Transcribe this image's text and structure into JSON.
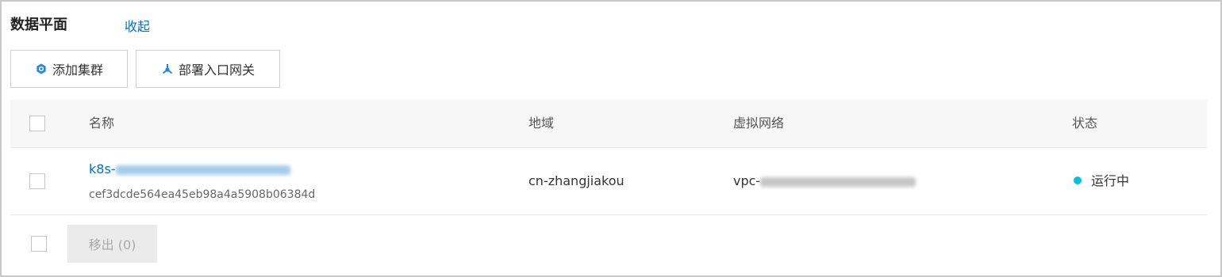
{
  "section": {
    "title": "数据平面",
    "collapse_label": "收起"
  },
  "toolbar": {
    "add_cluster_label": "添加集群",
    "deploy_gateway_label": "部署入口网关"
  },
  "table": {
    "columns": [
      "名称",
      "地域",
      "虚拟网络",
      "状态"
    ],
    "rows": [
      {
        "name_prefix": "k8s-",
        "cluster_id": "cef3dcde564ea45eb98a4a5908b06384d",
        "region": "cn-zhangjiakou",
        "vpc_prefix": "vpc-",
        "status": "运行中"
      }
    ]
  },
  "footer": {
    "remove_label": "移出 (0)"
  },
  "colors": {
    "link": "#0070cc",
    "status_running": "#00c1de",
    "primary_icon": "#1e88e5"
  }
}
